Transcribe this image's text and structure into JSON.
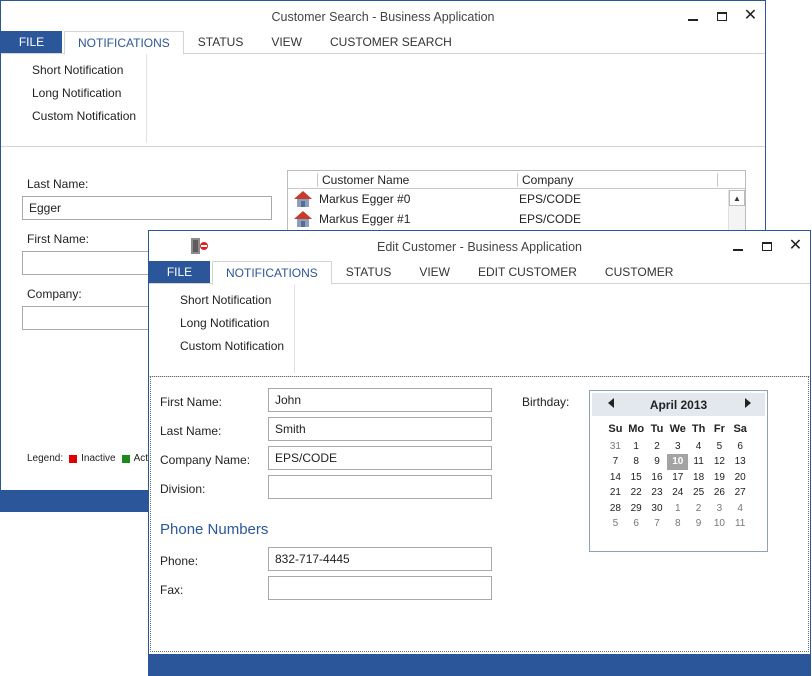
{
  "back_window": {
    "title": "Customer Search - Business Application",
    "tabs": [
      "FILE",
      "NOTIFICATIONS",
      "STATUS",
      "VIEW",
      "CUSTOMER SEARCH"
    ],
    "ribbon_items": [
      "Short Notification",
      "Long Notification",
      "Custom Notification"
    ],
    "form": {
      "last_name_label": "Last Name:",
      "last_name_value": "Egger",
      "first_name_label": "First Name:",
      "first_name_value": "",
      "company_label": "Company:",
      "company_value": ""
    },
    "grid": {
      "columns": [
        "Customer Name",
        "Company"
      ],
      "rows": [
        {
          "name": "Markus Egger #0",
          "company": "EPS/CODE"
        },
        {
          "name": "Markus Egger #1",
          "company": "EPS/CODE"
        }
      ]
    },
    "legend": {
      "label": "Legend:",
      "inactive": "Inactive",
      "active": "Acti",
      "inactive_color": "#e00000",
      "active_color": "#1a8a1a"
    }
  },
  "front_window": {
    "title": "Edit Customer - Business Application",
    "tabs": [
      "FILE",
      "NOTIFICATIONS",
      "STATUS",
      "VIEW",
      "EDIT CUSTOMER",
      "CUSTOMER"
    ],
    "ribbon_items": [
      "Short Notification",
      "Long Notification",
      "Custom Notification"
    ],
    "form": {
      "first_name_label": "First Name:",
      "first_name_value": "John",
      "last_name_label": "Last Name:",
      "last_name_value": "Smith",
      "company_label": "Company Name:",
      "company_value": "EPS/CODE",
      "division_label": "Division:",
      "division_value": "",
      "birthday_label": "Birthday:"
    },
    "phone": {
      "section_title": "Phone Numbers",
      "phone_label": "Phone:",
      "phone_value": "832-717-4445",
      "fax_label": "Fax:",
      "fax_value": ""
    },
    "calendar": {
      "month": "April 2013",
      "days_of_week": [
        "Su",
        "Mo",
        "Tu",
        "We",
        "Th",
        "Fr",
        "Sa"
      ],
      "weeks": [
        [
          "31",
          "1",
          "2",
          "3",
          "4",
          "5",
          "6"
        ],
        [
          "7",
          "8",
          "9",
          "10",
          "11",
          "12",
          "13"
        ],
        [
          "14",
          "15",
          "16",
          "17",
          "18",
          "19",
          "20"
        ],
        [
          "21",
          "22",
          "23",
          "24",
          "25",
          "26",
          "27"
        ],
        [
          "28",
          "29",
          "30",
          "1",
          "2",
          "3",
          "4"
        ],
        [
          "5",
          "6",
          "7",
          "8",
          "9",
          "10",
          "11"
        ]
      ],
      "selected": "10"
    }
  },
  "colors": {
    "accent": "#2b579a"
  }
}
